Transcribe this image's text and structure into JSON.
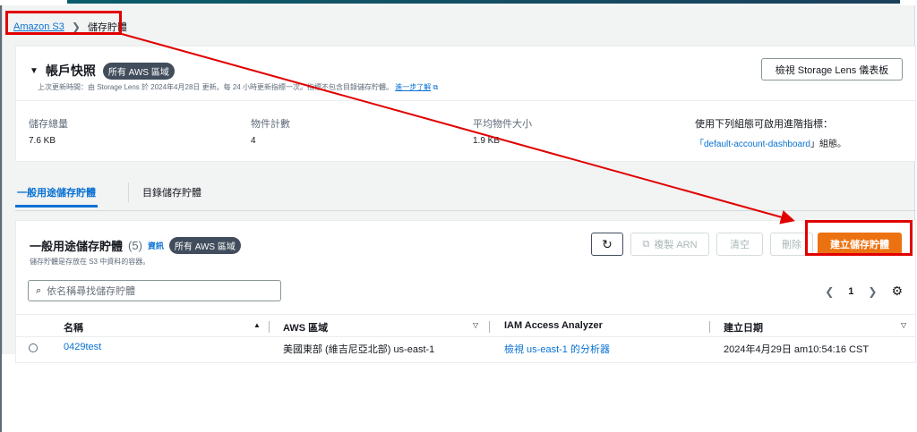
{
  "breadcrumb": {
    "root": "Amazon S3",
    "current": "儲存貯體"
  },
  "account_snapshot": {
    "title": "帳戶快照",
    "scope_badge": "所有 AWS 區域",
    "subtitle": "上次更新時間：由 Storage Lens 於 2024年4月28日 更新。每 24 小時更新指標一次。指標不包含目錄儲存貯體。",
    "learn_more": "進一步了解",
    "view_lens_button": "檢視 Storage Lens 儀表板",
    "metrics": [
      {
        "label": "儲存總量",
        "value": "7.6 KB"
      },
      {
        "label": "物件計數",
        "value": "4"
      },
      {
        "label": "平均物件大小",
        "value": "1.9 KB"
      }
    ],
    "dashboard_hint": "使用下列組態可啟用進階指標：",
    "dashboard_link": "default-account-dashboard",
    "dashboard_prefix": "「",
    "dashboard_suffix": "」組態。"
  },
  "tabs": [
    {
      "label": "一般用途儲存貯體",
      "active": true
    },
    {
      "label": "目錄儲存貯體",
      "active": false
    }
  ],
  "buckets_panel": {
    "title": "一般用途儲存貯體",
    "count": "(5)",
    "info_link": "資訊",
    "scope_badge": "所有 AWS 區域",
    "subtitle": "儲存貯體是存放在 S3 中資料的容器。",
    "buttons": {
      "copy_arn": "複製 ARN",
      "empty": "清空",
      "delete": "刪除",
      "create": "建立儲存貯體"
    },
    "search_placeholder": "依名稱尋找儲存貯體",
    "page_number": "1",
    "columns": [
      "名稱",
      "AWS 區域",
      "IAM Access Analyzer",
      "建立日期"
    ],
    "rows": [
      {
        "name": "0429test",
        "region": "美國東部 (維吉尼亞北部) us-east-1",
        "analyzer": "檢視 us-east-1 的分析器",
        "created": "2024年4月29日 am10:54:16 CST"
      }
    ]
  },
  "colors": {
    "accent": "#0972d3",
    "primary_button": "#ec7211",
    "annotation": "#e10000"
  }
}
